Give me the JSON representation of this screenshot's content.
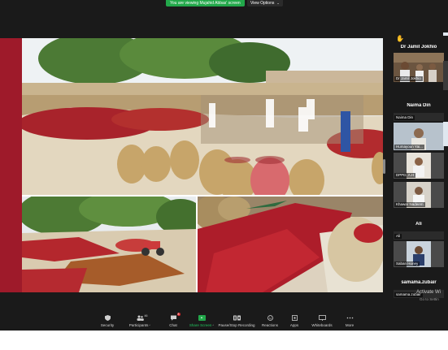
{
  "banner": {
    "sharing_text": "You are viewing Mujahid Abbas' screen",
    "view_options_label": "View Options"
  },
  "gallery": {
    "participants": [
      {
        "display_name": "Dr Jamil Jokhio",
        "tile_label": "Dr Jamil Jokhio",
        "tile_type": "video"
      },
      {
        "display_name": "Naima Din",
        "tile_label": "Naima Din",
        "tile_type": "name"
      },
      {
        "display_name": "",
        "tile_label": "Humayoun Yai...",
        "tile_type": "video"
      },
      {
        "display_name": "",
        "tile_label": "DPPD, A.H",
        "tile_type": "video"
      },
      {
        "display_name": "",
        "tile_label": "Khawar Nadeem",
        "tile_type": "video"
      },
      {
        "display_name": "Ali",
        "tile_label": "Ali",
        "tile_type": "name"
      },
      {
        "display_name": "",
        "tile_label": "Saban Honey",
        "tile_type": "video"
      },
      {
        "display_name": "samama.zubair",
        "tile_label": "samama.zubair",
        "tile_type": "name"
      }
    ]
  },
  "watermark": {
    "title": "Activate Wi",
    "subtitle": "Go to Settin"
  },
  "toolbar": {
    "buttons": [
      {
        "label": "Security",
        "icon": "shield-icon"
      },
      {
        "label": "Participants",
        "icon": "participants-icon",
        "count": "46"
      },
      {
        "label": "Chat",
        "icon": "chat-icon",
        "badge": "8"
      },
      {
        "label": "Share Screen",
        "icon": "share-screen-icon"
      },
      {
        "label": "Pause/Stop Recording",
        "icon": "pause-stop-icon"
      },
      {
        "label": "Reactions",
        "icon": "reactions-icon"
      },
      {
        "label": "Apps",
        "icon": "apps-icon"
      },
      {
        "label": "Whiteboards",
        "icon": "whiteboard-icon"
      },
      {
        "label": "More",
        "icon": "more-icon"
      }
    ]
  },
  "colors": {
    "share_green": "#22a84a",
    "slide_accent": "#9e1a2a",
    "meeting_bg": "#1a1a1a"
  }
}
